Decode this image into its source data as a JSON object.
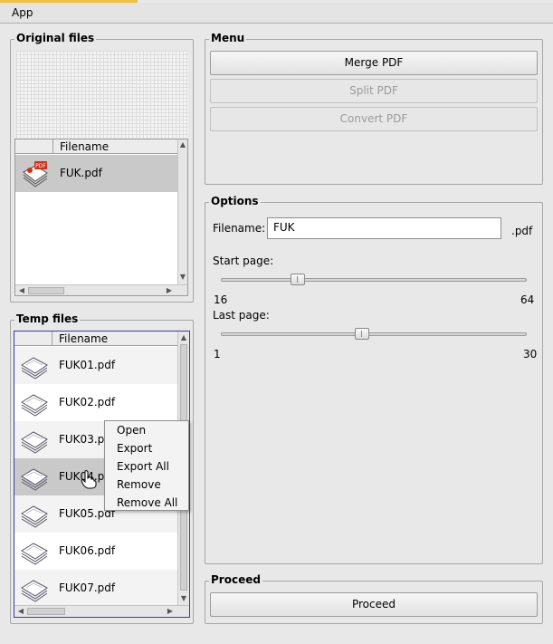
{
  "menubar": {
    "app_label": "App"
  },
  "original_files": {
    "title": "Original files",
    "header": "Filename",
    "rows": [
      {
        "filename": "FUK.pdf",
        "icon": "pdf-file-icon"
      }
    ]
  },
  "temp_files": {
    "title": "Temp files",
    "header": "Filename",
    "rows": [
      {
        "filename": "FUK01.pdf",
        "icon": "page-stack-icon"
      },
      {
        "filename": "FUK02.pdf",
        "icon": "page-stack-icon"
      },
      {
        "filename": "FUK03.pdf",
        "icon": "page-stack-icon"
      },
      {
        "filename": "FUK04.pdf",
        "icon": "page-stack-icon"
      },
      {
        "filename": "FUK05.pdf",
        "icon": "page-stack-icon"
      },
      {
        "filename": "FUK06.pdf",
        "icon": "page-stack-icon"
      },
      {
        "filename": "FUK07.pdf",
        "icon": "page-stack-icon"
      }
    ],
    "selected_index": 3
  },
  "context_menu": {
    "items": [
      "Open",
      "Export",
      "Export All",
      "Remove",
      "Remove All"
    ]
  },
  "menu": {
    "title": "Menu",
    "merge_label": "Merge PDF",
    "split_label": "Split PDF",
    "convert_label": "Convert PDF"
  },
  "options": {
    "title": "Options",
    "filename_label": "Filename:",
    "filename_value": "FUK",
    "extension": ".pdf",
    "start_page": {
      "label": "Start page:",
      "min_label": "16",
      "max_label": "64",
      "fraction": 0.24
    },
    "last_page": {
      "label": "Last page:",
      "min_label": "1",
      "max_label": "30",
      "fraction": 0.46
    }
  },
  "proceed": {
    "title": "Proceed",
    "button_label": "Proceed"
  }
}
